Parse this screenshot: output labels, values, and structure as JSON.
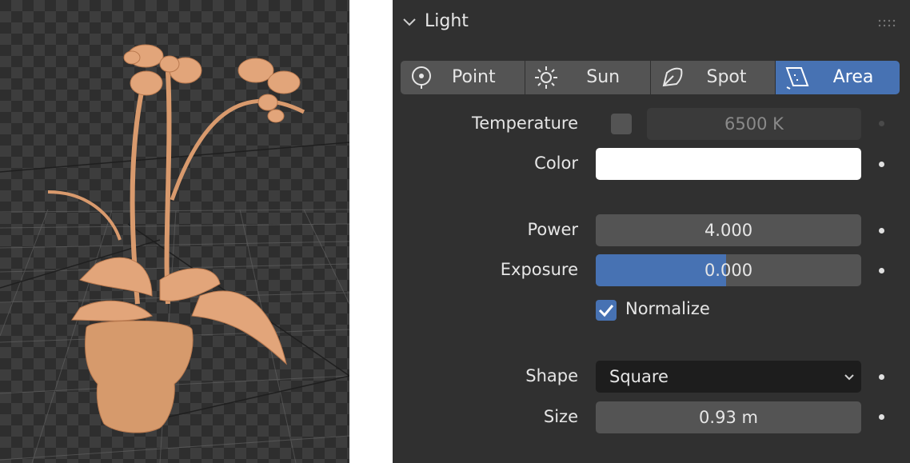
{
  "viewport": {
    "object": "potted orchid plant"
  },
  "panel": {
    "title": "Light",
    "light_types": [
      {
        "label": "Point",
        "icon": "point-light-icon",
        "active": false
      },
      {
        "label": "Sun",
        "icon": "sun-light-icon",
        "active": false
      },
      {
        "label": "Spot",
        "icon": "spot-light-icon",
        "active": false
      },
      {
        "label": "Area",
        "icon": "area-light-icon",
        "active": true
      }
    ],
    "temperature": {
      "label": "Temperature",
      "value": "6500 K",
      "enabled": false
    },
    "color": {
      "label": "Color",
      "value": "#ffffff"
    },
    "power": {
      "label": "Power",
      "value": "4.000"
    },
    "exposure": {
      "label": "Exposure",
      "value": "0.000",
      "fill_fraction": 0.49
    },
    "normalize": {
      "label": "Normalize",
      "checked": true
    },
    "shape": {
      "label": "Shape",
      "value": "Square"
    },
    "size": {
      "label": "Size",
      "value": "0.93 m"
    }
  },
  "colors": {
    "accent": "#4772b3",
    "panel_bg": "#303030",
    "field_bg": "#545454",
    "plant": "#e2a57a"
  }
}
